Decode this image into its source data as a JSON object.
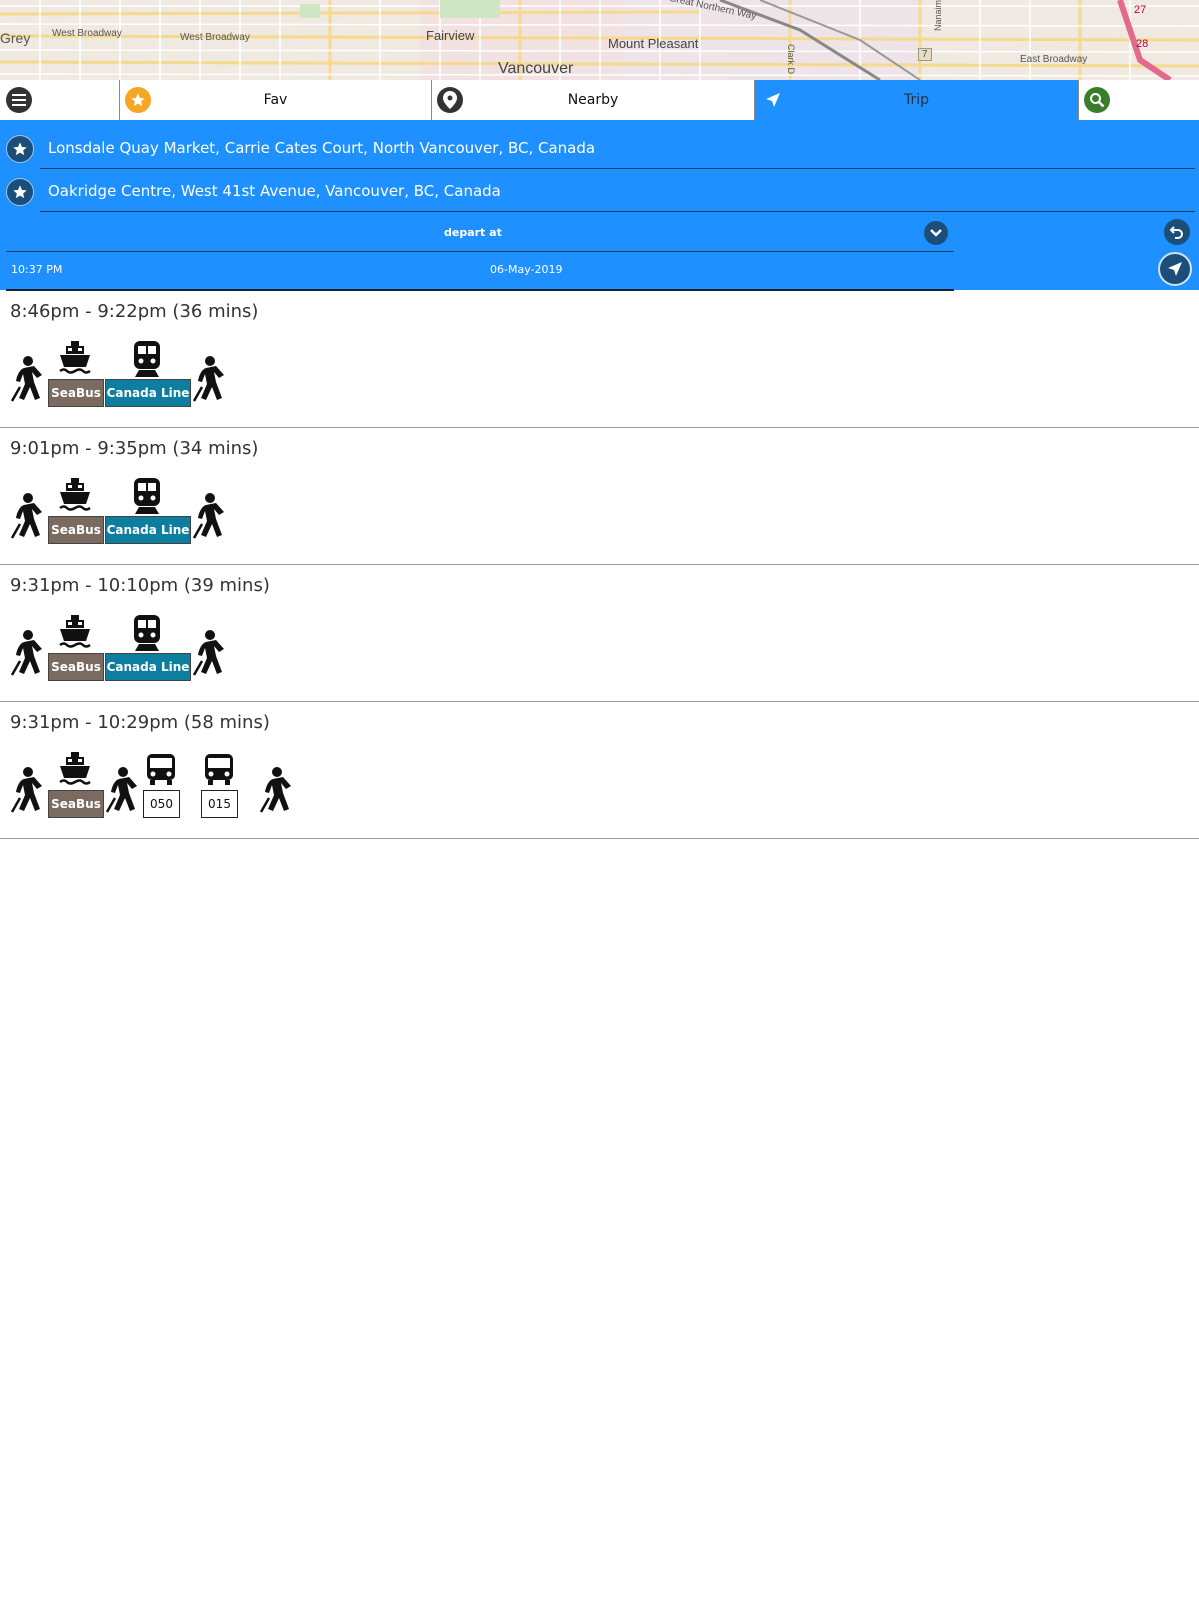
{
  "map": {
    "labels": [
      "Grey",
      "West Broadway",
      "West Broadway",
      "Fairview",
      "Mount Pleasant",
      "Vancouver",
      "Great Northern Way",
      "East Broadway",
      "7",
      "27",
      "28",
      "Clark D",
      "Nanaimo"
    ]
  },
  "tabs": {
    "menu_icon": "menu-icon",
    "fav": {
      "label": "Fav",
      "icon": "star-icon",
      "color": "#f5a623"
    },
    "nearby": {
      "label": "Nearby",
      "icon": "map-pin-icon"
    },
    "trip": {
      "label": "Trip",
      "icon": "navigation-arrow-icon"
    },
    "search": {
      "icon": "search-icon",
      "color": "#3a7d2c"
    }
  },
  "trip_form": {
    "from": "Lonsdale Quay Market, Carrie Cates Court, North Vancouver, BC, Canada",
    "to": "Oakridge Centre, West 41st Avenue, Vancouver, BC, Canada",
    "mode_label": "depart at",
    "time": "10:37 PM",
    "date": "06-May-2019",
    "accent_color": "#1e90ff"
  },
  "results": [
    {
      "title": "8:46pm - 9:22pm (36 mins)",
      "legs": [
        {
          "type": "walk"
        },
        {
          "type": "ferry",
          "label": "SeaBus"
        },
        {
          "type": "train",
          "label": "Canada Line"
        },
        {
          "type": "walk"
        }
      ]
    },
    {
      "title": "9:01pm - 9:35pm (34 mins)",
      "legs": [
        {
          "type": "walk"
        },
        {
          "type": "ferry",
          "label": "SeaBus"
        },
        {
          "type": "train",
          "label": "Canada Line"
        },
        {
          "type": "walk"
        }
      ]
    },
    {
      "title": "9:31pm - 10:10pm (39 mins)",
      "legs": [
        {
          "type": "walk"
        },
        {
          "type": "ferry",
          "label": "SeaBus"
        },
        {
          "type": "train",
          "label": "Canada Line"
        },
        {
          "type": "walk"
        }
      ]
    },
    {
      "title": "9:31pm - 10:29pm (58 mins)",
      "legs": [
        {
          "type": "walk"
        },
        {
          "type": "ferry",
          "label": "SeaBus"
        },
        {
          "type": "walk"
        },
        {
          "type": "bus",
          "label": "050"
        },
        {
          "type": "bus",
          "label": "015"
        },
        {
          "type": "walk"
        }
      ]
    }
  ]
}
